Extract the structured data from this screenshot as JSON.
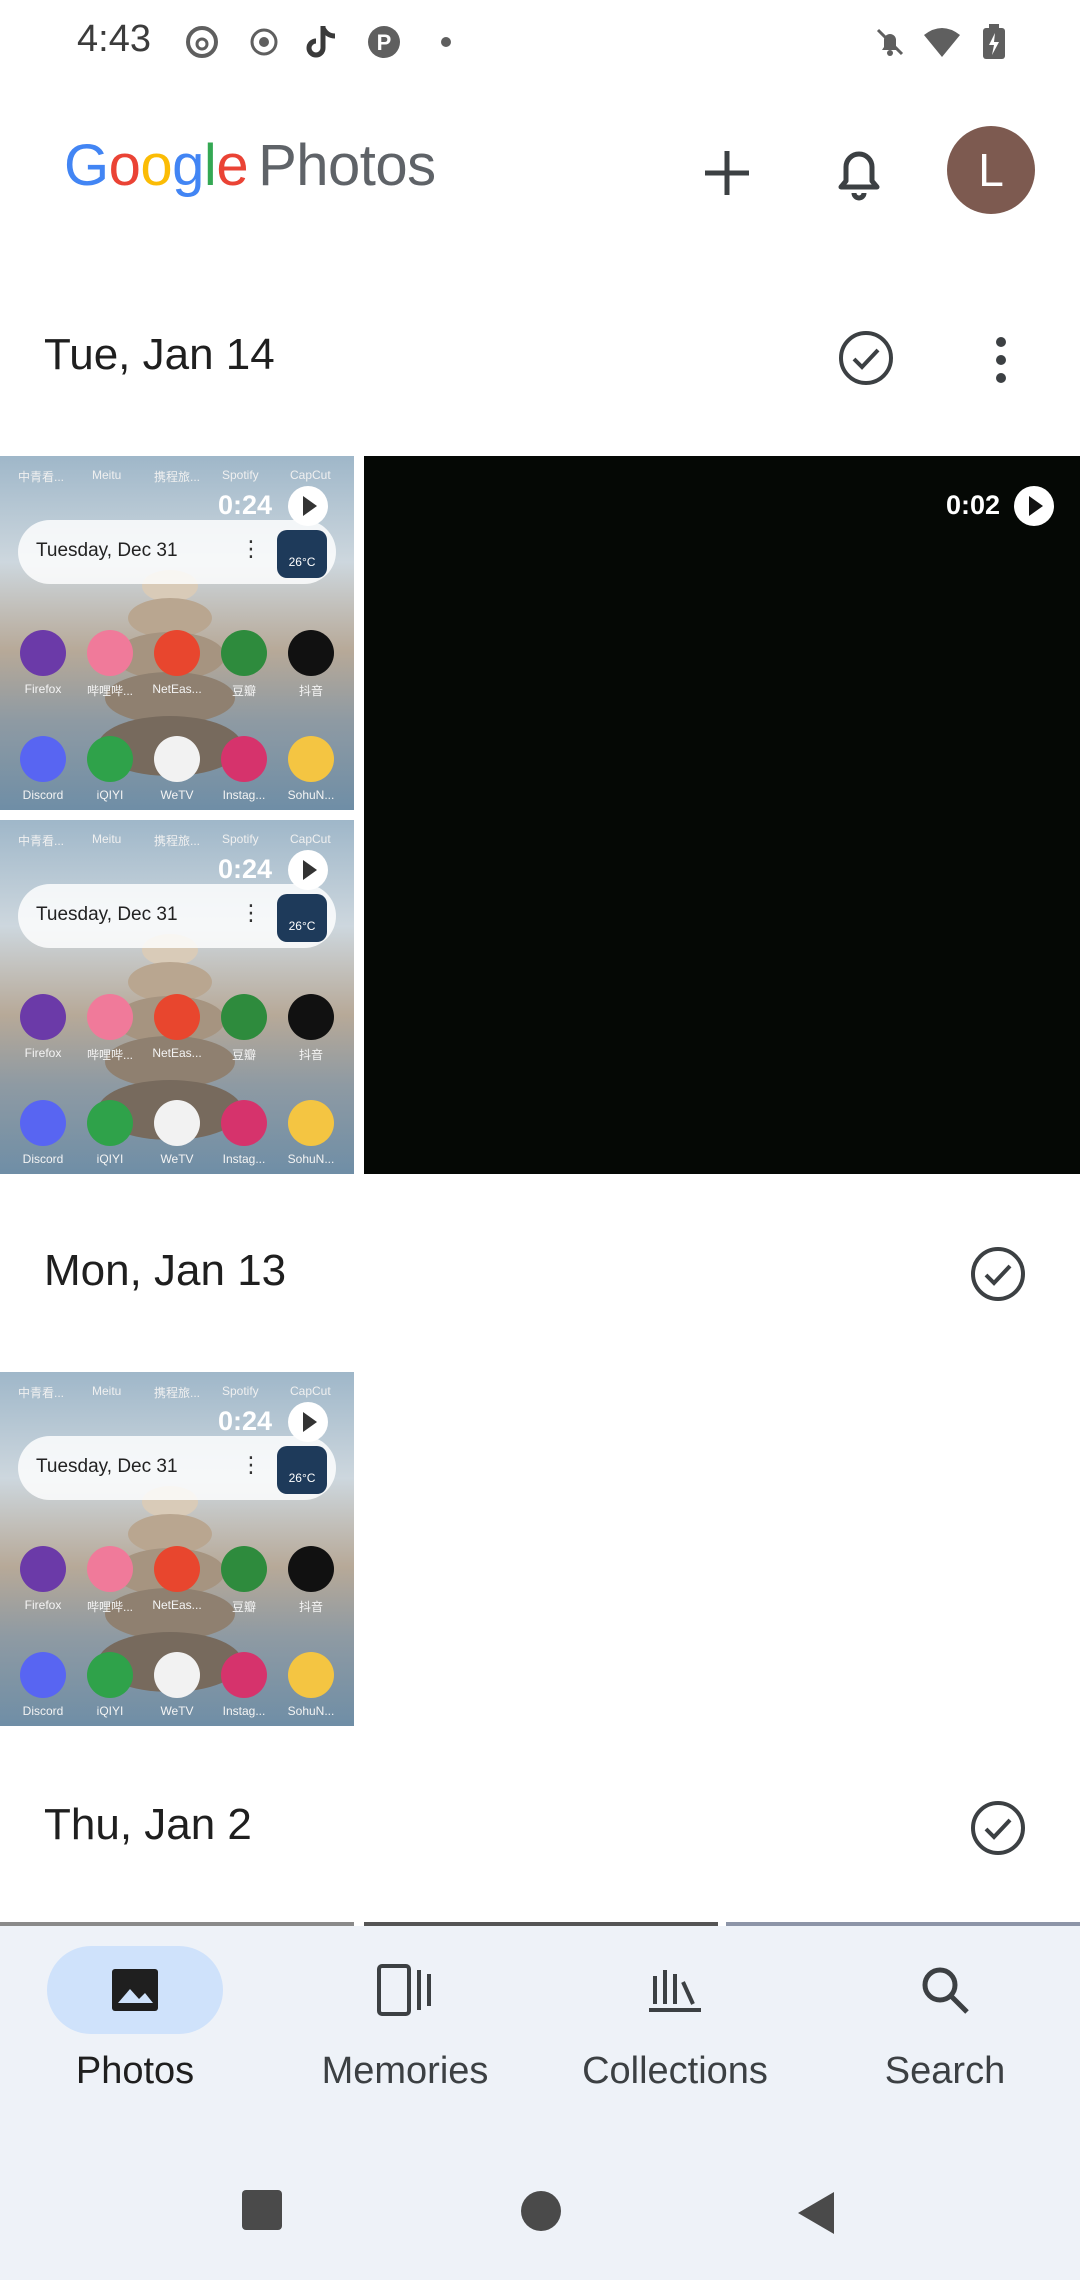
{
  "status_bar": {
    "time": "4:43"
  },
  "app": {
    "logo_google": [
      "G",
      "o",
      "o",
      "g",
      "l",
      "e"
    ],
    "logo_photos": "Photos",
    "avatar_initial": "L"
  },
  "sections": [
    {
      "date": "Tue, Jan 14"
    },
    {
      "date": "Mon, Jan 13"
    },
    {
      "date": "Thu, Jan 2"
    }
  ],
  "thumb": {
    "duration": "0:24",
    "widget_date": "Tuesday, Dec 31",
    "weather_temp": "26°C",
    "top_labels": [
      "中青看...",
      "Meitu",
      "携程旅...",
      "Spotify",
      "CapCut"
    ],
    "row1_labels": [
      "Firefox",
      "哔哩哔...",
      "NetEas...",
      "豆瓣",
      "抖音"
    ],
    "row2_labels": [
      "Discord",
      "iQIYI",
      "WeTV",
      "Instag...",
      "SohuN..."
    ]
  },
  "video": {
    "duration": "0:02"
  },
  "bottom_nav": [
    {
      "label": "Photos"
    },
    {
      "label": "Memories"
    },
    {
      "label": "Collections"
    },
    {
      "label": "Search"
    }
  ],
  "colors": {
    "accent_pill": "#cfe2fb",
    "nav_bg": "#eef2f8",
    "avatar": "#7d5a50"
  }
}
